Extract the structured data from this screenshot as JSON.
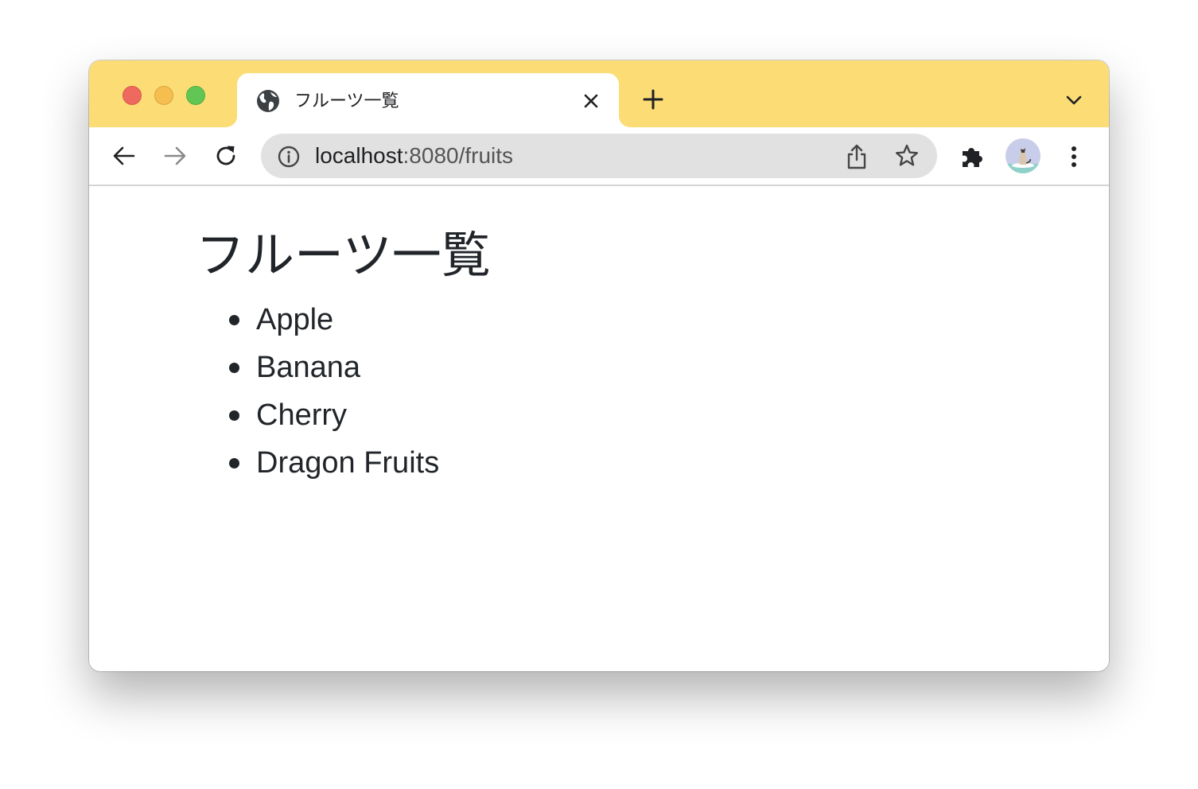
{
  "browser": {
    "tab": {
      "title": "フルーツ一覧",
      "favicon": "globe-icon"
    },
    "address_bar": {
      "host": "localhost",
      "path": ":8080/fruits"
    },
    "colors": {
      "tabstrip": "#fcdd75",
      "traffic_close": "#ef6a5e",
      "traffic_minimize": "#f5be4f",
      "traffic_maximize": "#62c655"
    },
    "icons": {
      "back": "arrow-left-icon",
      "forward": "arrow-right-icon",
      "reload": "reload-icon",
      "info": "info-icon",
      "share": "share-icon",
      "bookmark": "star-icon",
      "extensions": "puzzle-icon",
      "profile": "avatar",
      "menu": "more-vertical-icon",
      "new_tab": "plus-icon",
      "tab_search": "chevron-down-icon"
    }
  },
  "page": {
    "heading": "フルーツ一覧",
    "fruits": [
      "Apple",
      "Banana",
      "Cherry",
      "Dragon Fruits"
    ],
    "text_color": "#212529"
  }
}
